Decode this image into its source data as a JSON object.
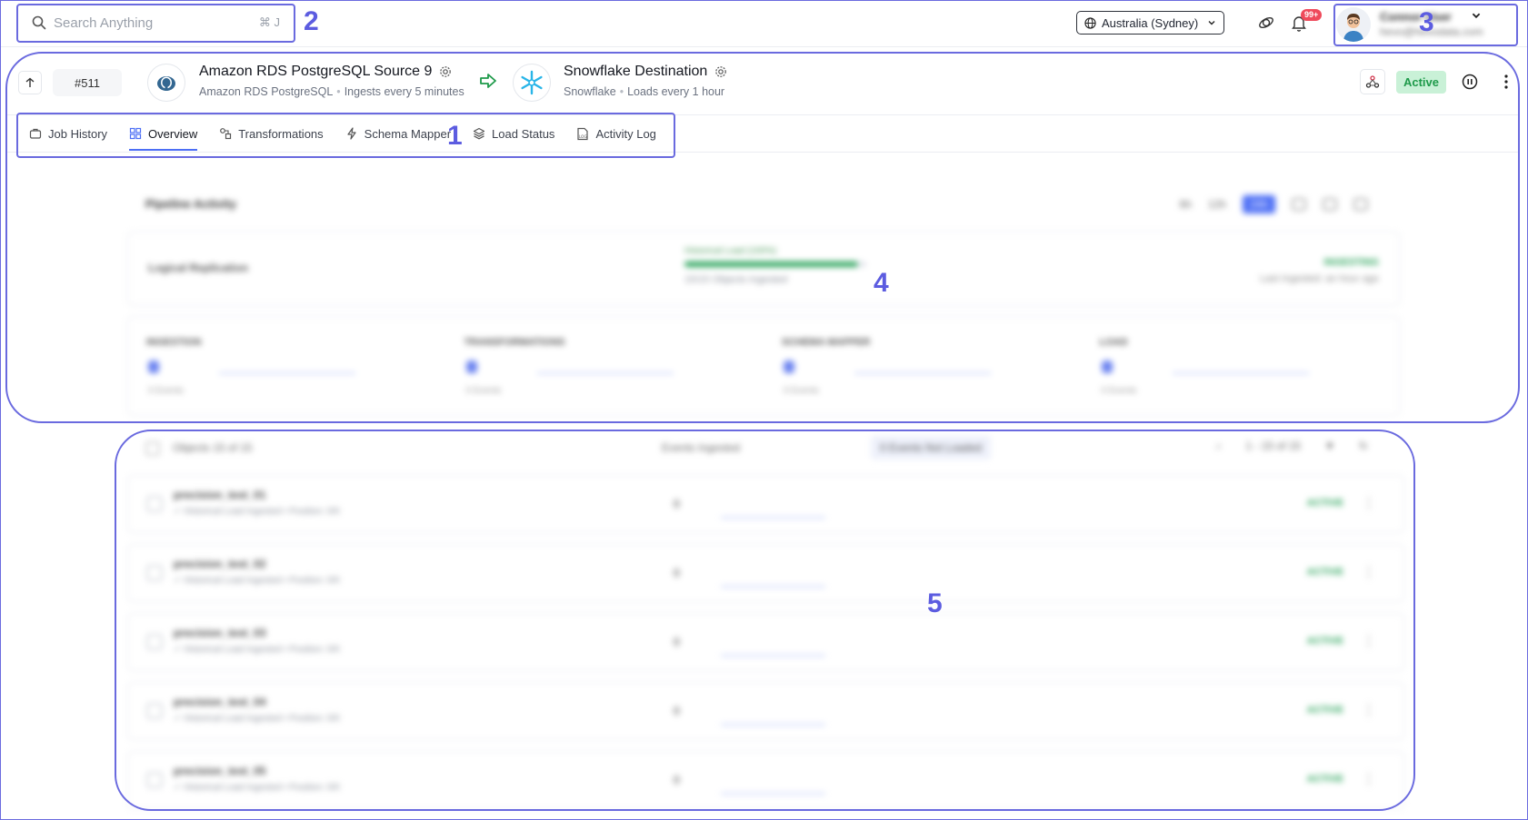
{
  "topbar": {
    "search_placeholder": "Search Anything",
    "search_shortcut": "⌘ J",
    "region": "Australia (Sydney)",
    "notification_count": "99+",
    "user_name": "Connor User",
    "user_email": "hevo@hevodata.com"
  },
  "pipeline": {
    "job_id": "#511",
    "source_name": "Amazon RDS PostgreSQL Source 9",
    "source_type": "Amazon RDS PostgreSQL",
    "source_schedule": "Ingests every 5 minutes",
    "dest_name": "Snowflake Destination",
    "dest_type": "Snowflake",
    "dest_schedule": "Loads every 1 hour",
    "status": "Active"
  },
  "tabs": [
    {
      "label": "Job History",
      "icon": "briefcase-icon"
    },
    {
      "label": "Overview",
      "icon": "grid-icon"
    },
    {
      "label": "Transformations",
      "icon": "transform-icon"
    },
    {
      "label": "Schema Mapper",
      "icon": "bolt-icon"
    },
    {
      "label": "Load Status",
      "icon": "layers-icon"
    },
    {
      "label": "Activity Log",
      "icon": "log-icon"
    }
  ],
  "active_tab": "Overview",
  "activity": {
    "title": "Pipeline Activity",
    "ranges": [
      "6h",
      "12h",
      "24h"
    ],
    "selected_range": "24h",
    "replication_title": "Logical Replication",
    "historical_label": "Historical Load (100%)",
    "historical_progress": 0.95,
    "objects_ingested": "15/15 Objects Ingested",
    "replication_status": "INGESTING",
    "last_ingested": "Last Ingested: an hour ago",
    "stages": [
      {
        "title": "INGESTION",
        "events": "0 Events"
      },
      {
        "title": "TRANSFORMATIONS",
        "events": "0 Events"
      },
      {
        "title": "SCHEMA MAPPER",
        "events": "0 Events"
      },
      {
        "title": "LOAD",
        "events": "0 Events"
      }
    ]
  },
  "objects": {
    "header_count": "Objects 15 of 15",
    "header_events": "Events Ingested",
    "header_not_loaded": "0 Events Not Loaded",
    "pagination": "1 - 15 of 15",
    "rows": [
      {
        "name": "precision_test_01",
        "sub": "✓ Historical Load Ingested • Position: 0/0",
        "events": "0",
        "status": "ACTIVE"
      },
      {
        "name": "precision_test_02",
        "sub": "✓ Historical Load Ingested • Position: 0/0",
        "events": "0",
        "status": "ACTIVE"
      },
      {
        "name": "precision_test_03",
        "sub": "✓ Historical Load Ingested • Position: 0/0",
        "events": "0",
        "status": "ACTIVE"
      },
      {
        "name": "precision_test_04",
        "sub": "✓ Historical Load Ingested • Position: 0/0",
        "events": "0",
        "status": "ACTIVE"
      },
      {
        "name": "precision_test_05",
        "sub": "✓ Historical Load Ingested • Position: 0/0",
        "events": "0",
        "status": "ACTIVE"
      }
    ]
  },
  "annotations": [
    "1",
    "2",
    "3",
    "4",
    "5"
  ],
  "colors": {
    "accent": "#4c6ef5",
    "annotation": "#6a6adf",
    "active_bg": "#c9f1d7",
    "active_text": "#1e9a4a",
    "notification": "#ef4a5b"
  }
}
